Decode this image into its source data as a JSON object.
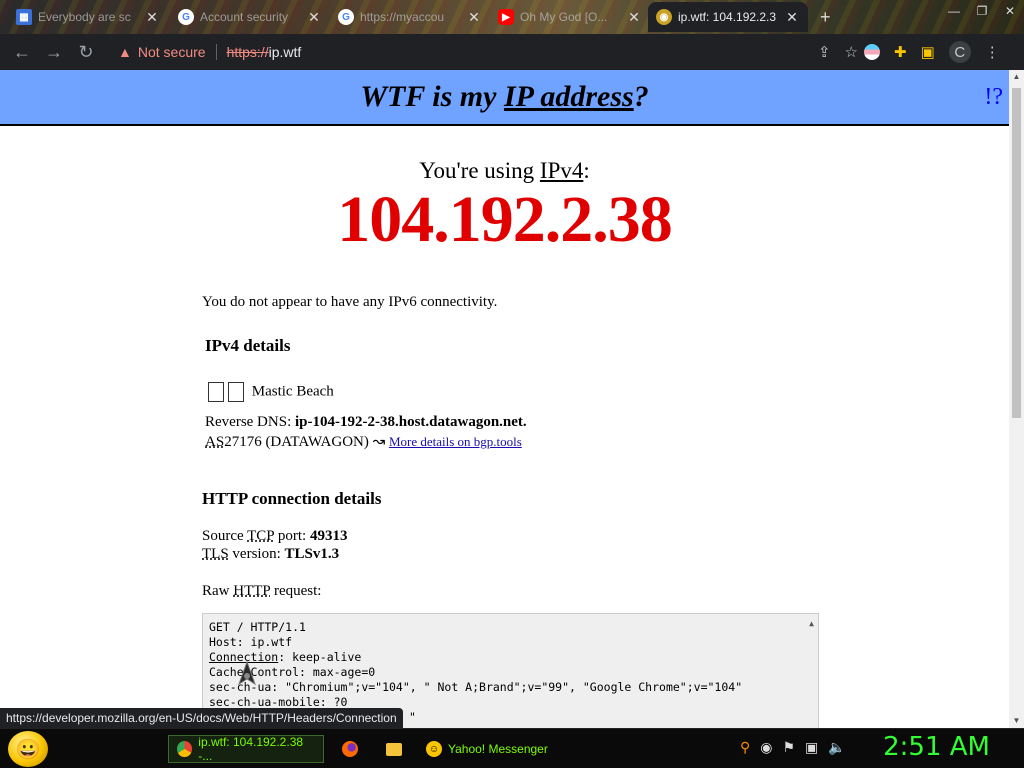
{
  "browser": {
    "tabs": [
      {
        "label": "Everybody are sc",
        "icon": "windows-icon",
        "active": false
      },
      {
        "label": "Account security",
        "icon": "google-icon",
        "active": false
      },
      {
        "label": "https://myaccou",
        "icon": "google-icon",
        "active": false
      },
      {
        "label": "Oh My God [O...",
        "icon": "youtube-icon",
        "active": false
      },
      {
        "label": "ip.wtf: 104.192.2.3",
        "icon": "ipwtf-icon",
        "active": true
      }
    ],
    "new_tab": "+",
    "security_label": "Not secure",
    "url_scheme": "https://",
    "url_host": "ip.wtf",
    "profile_initial": "C"
  },
  "page": {
    "title_part1": "WTF is my ",
    "title_link": "IP address",
    "title_part2": "?",
    "help_link": "!?",
    "using_prefix": "You're using ",
    "using_version": "IPv4",
    "using_suffix": ":",
    "ip": "104.192.2.38",
    "ipv6_note": "You do not appear to have any IPv6 connectivity.",
    "ipv4_heading": "IPv4 details",
    "location": "Mastic Beach",
    "rdns_label": "Reverse DNS: ",
    "rdns_value": "ip-104-192-2-38.host.datawagon.net.",
    "as_label": "AS",
    "as_value": "27176 (DATAWAGON) ",
    "as_arrow": "↝",
    "bgp_link": "More details on bgp.tools",
    "http_heading": "HTTP connection details",
    "source_label_pre": "Source ",
    "source_tcp": "TCP",
    "source_label_post": " port: ",
    "source_port": "49313",
    "tls_abbr": "TLS",
    "tls_label_post": " version: ",
    "tls_version": "TLSv1.3",
    "raw_label_pre": "Raw ",
    "raw_http": "HTTP",
    "raw_label_post": " request:",
    "raw_lines": [
      "GET / HTTP/1.1",
      "Host: ip.wtf",
      "Connection: keep-alive",
      "Cache-Control: max-age=0",
      "sec-ch-ua: \"Chromium\";v=\"104\", \" Not A;Brand\";v=\"99\", \"Google Chrome\";v=\"104\"",
      "sec-ch-ua-mobile: ?0",
      "\""
    ]
  },
  "status_url": "https://developer.mozilla.org/en-US/docs/Web/HTTP/Headers/Connection",
  "taskbar": {
    "tasks": [
      {
        "label": "ip.wtf: 104.192.2.38 -...",
        "icon": "chrome-icon",
        "active": true
      },
      {
        "label": "Yahoo! Messenger",
        "icon": "yahoo-messenger-icon",
        "active": false
      }
    ],
    "clock": "2:51 AM"
  }
}
